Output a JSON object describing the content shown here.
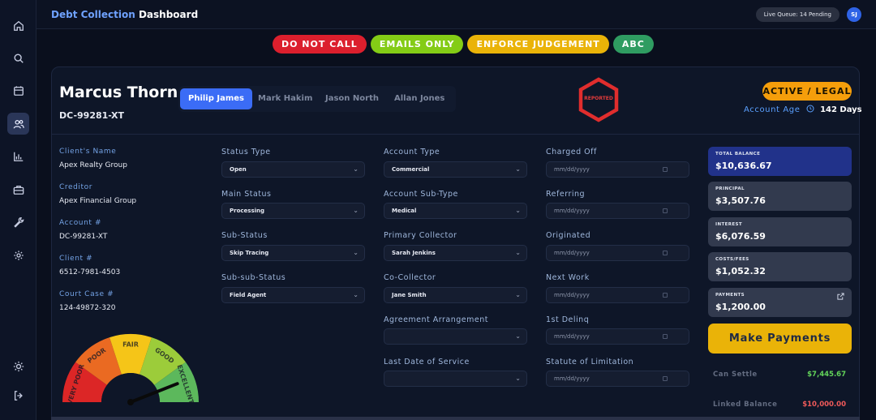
{
  "header": {
    "title_accent": "Debt Collection",
    "title_rest": "Dashboard",
    "queue": "Live Queue: 14 Pending",
    "avatar_initials": "SJ"
  },
  "sidebar": {
    "items": [
      {
        "icon": "home-icon"
      },
      {
        "icon": "search-icon"
      },
      {
        "icon": "calendar-icon"
      },
      {
        "icon": "users-icon",
        "active": true
      },
      {
        "icon": "bar-chart-icon"
      },
      {
        "icon": "briefcase-icon"
      },
      {
        "icon": "wrench-icon"
      },
      {
        "icon": "gear-icon"
      }
    ],
    "bottom": [
      {
        "icon": "sun-icon"
      },
      {
        "icon": "logout-icon"
      }
    ]
  },
  "tags": [
    {
      "label": "DO NOT CALL",
      "color": "#dc1f2d"
    },
    {
      "label": "EMAILS ONLY",
      "color": "#84cc16"
    },
    {
      "label": "ENFORCE JUDGEMENT",
      "color": "#eab308"
    },
    {
      "label": "ABC",
      "color": "#2f9c61"
    }
  ],
  "debtor": {
    "name": "Marcus Thorne",
    "id": "DC-99281-XT",
    "reported_label": "REPORTED",
    "status": "ACTIVE / LEGAL",
    "account_age_label": "Account Age",
    "account_age_value": "142 Days"
  },
  "people_tabs": [
    "Philip James",
    "Mark Hakim",
    "Jason North",
    "Allan Jones"
  ],
  "info": [
    {
      "label": "Client's Name",
      "value": "Apex Realty Group"
    },
    {
      "label": "Creditor",
      "value": "Apex Financial Group"
    },
    {
      "label": "Account #",
      "value": "DC-99281-XT"
    },
    {
      "label": "Client #",
      "value": "6512-7981-4503"
    },
    {
      "label": "Court Case #",
      "value": "124-49872-320"
    }
  ],
  "fields": {
    "status_type": {
      "label": "Status Type",
      "value": "Open"
    },
    "main_status": {
      "label": "Main Status",
      "value": "Processing"
    },
    "sub_status": {
      "label": "Sub-Status",
      "value": "Skip Tracing"
    },
    "sub_sub_status": {
      "label": "Sub-sub-Status",
      "value": "Field Agent"
    },
    "account_type": {
      "label": "Account Type",
      "value": "Commercial"
    },
    "account_sub_type": {
      "label": "Account Sub-Type",
      "value": "Medical"
    },
    "primary_collector": {
      "label": "Primary Collector",
      "value": "Sarah Jenkins"
    },
    "co_collector": {
      "label": "Co-Collector",
      "value": "Jane Smith"
    },
    "agreement": {
      "label": "Agreement Arrangement",
      "value": ""
    },
    "last_service": {
      "label": "Last Date of Service",
      "value": ""
    },
    "charged_off": {
      "label": "Charged Off",
      "value": "mm/dd/yyyy"
    },
    "referring": {
      "label": "Referring",
      "value": "mm/dd/yyyy"
    },
    "originated": {
      "label": "Originated",
      "value": "mm/dd/yyyy"
    },
    "next_work": {
      "label": "Next Work",
      "value": "mm/dd/yyyy"
    },
    "first_delinq": {
      "label": "1st Delinq",
      "value": "mm/dd/yyyy"
    },
    "statute": {
      "label": "Statute of Limitation",
      "value": "mm/dd/yyyy"
    }
  },
  "balances": [
    {
      "label": "TOTAL BALANCE",
      "value": "$10,636.67"
    },
    {
      "label": "PRINCIPAL",
      "value": "$3,507.76"
    },
    {
      "label": "INTEREST",
      "value": "$6,076.59"
    },
    {
      "label": "COSTS/FEES",
      "value": "$1,052.32"
    },
    {
      "label": "PAYMENTS",
      "value": "$1,200.00"
    }
  ],
  "make_payments": "Make Payments",
  "summary": {
    "can_settle_label": "Can Settle",
    "can_settle_value": "$7,445.67",
    "linked_label": "Linked Balance",
    "linked_value": "$10,000.00"
  },
  "gauge": {
    "labels": [
      "VERY POOR",
      "POOR",
      "FAIR",
      "GOOD",
      "EXCELLENT"
    ],
    "colors": [
      "#dc2626",
      "#ea6a22",
      "#f5c518",
      "#9ccc3a",
      "#5cb85c"
    ],
    "level": 0.88
  }
}
